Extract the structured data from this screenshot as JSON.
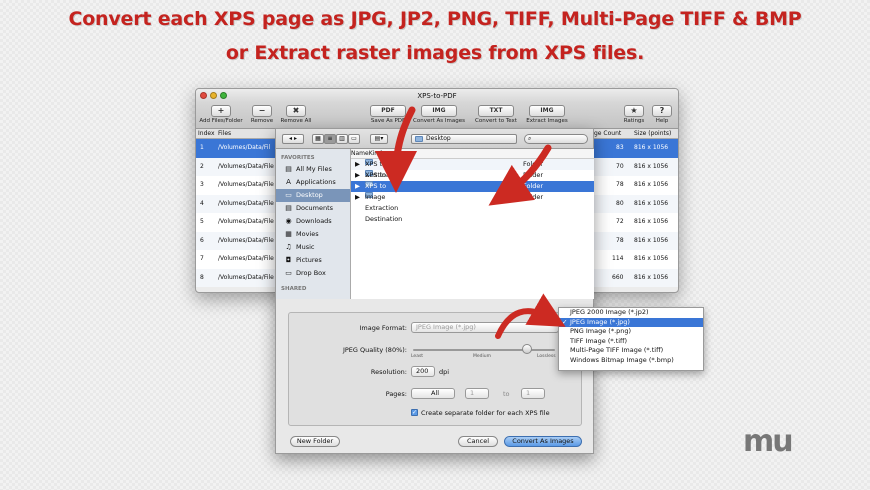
{
  "headline": {
    "line1": "Convert each XPS page as JPG, JP2, PNG, TIFF, Multi-Page TIFF & BMP",
    "line2": "or Extract raster images from XPS files."
  },
  "window": {
    "title": "XPS-to-PDF",
    "toolbar": {
      "add": {
        "icon": "+",
        "label": "Add Files/Folder"
      },
      "remove": {
        "icon": "−",
        "label": "Remove"
      },
      "remove_all": {
        "icon": "✖",
        "label": "Remove All"
      },
      "save_pdf": {
        "icon": "PDF",
        "label": "Save As PDF"
      },
      "conv_img": {
        "icon": "IMG",
        "label": "Convert As Images"
      },
      "conv_txt": {
        "icon": "TXT",
        "label": "Convert to Text"
      },
      "extract": {
        "icon": "IMG",
        "label": "Extract Images"
      },
      "ratings": {
        "icon": "★",
        "label": "Ratings"
      },
      "help": {
        "icon": "?",
        "label": "Help"
      }
    },
    "columns": {
      "index": "Index",
      "files": "Files",
      "page_count": "ge Count",
      "size": "Size (points)"
    },
    "rows": [
      {
        "i": "1",
        "f": "/Volumes/Data/Fil",
        "c": "83",
        "s": "816 x 1056"
      },
      {
        "i": "2",
        "f": "/Volumes/Data/File",
        "c": "70",
        "s": "816 x 1056"
      },
      {
        "i": "3",
        "f": "/Volumes/Data/File",
        "c": "78",
        "s": "816 x 1056"
      },
      {
        "i": "4",
        "f": "/Volumes/Data/File",
        "c": "80",
        "s": "816 x 1056"
      },
      {
        "i": "5",
        "f": "/Volumes/Data/File",
        "c": "72",
        "s": "816 x 1056"
      },
      {
        "i": "6",
        "f": "/Volumes/Data/File",
        "c": "78",
        "s": "816 x 1056"
      },
      {
        "i": "7",
        "f": "/Volumes/Data/File",
        "c": "114",
        "s": "816 x 1056"
      },
      {
        "i": "8",
        "f": "/Volumes/Data/File",
        "c": "660",
        "s": "816 x 1056"
      }
    ]
  },
  "sheet": {
    "location": "Desktop",
    "sidebar_favorites": "FAVORITES",
    "sidebar_shared": "SHARED",
    "sidebar": [
      {
        "icon": "▤",
        "label": "All My Files"
      },
      {
        "icon": "A",
        "label": "Applications"
      },
      {
        "icon": "▭",
        "label": "Desktop"
      },
      {
        "icon": "▤",
        "label": "Documents"
      },
      {
        "icon": "◉",
        "label": "Downloads"
      },
      {
        "icon": "▦",
        "label": "Movies"
      },
      {
        "icon": "♫",
        "label": "Music"
      },
      {
        "icon": "◘",
        "label": "Pictures"
      },
      {
        "icon": "▭",
        "label": "Drop Box"
      }
    ],
    "col_name": "Name",
    "col_kind": "Kind",
    "files": [
      {
        "name": "XPS to Text Destination",
        "kind": "Folder"
      },
      {
        "name": "XPS to PDF Destination",
        "kind": "Folder"
      },
      {
        "name": "XPS to Image Destination",
        "kind": "Folder"
      },
      {
        "name": "Image Extraction Destination",
        "kind": "Folder"
      }
    ],
    "options": {
      "format_label": "Image Format:",
      "format_value": "JPEG Image (*.jpg)",
      "quality_label": "JPEG Quality (80%):",
      "quality": 0.8,
      "q_least": "Least",
      "q_medium": "Medium",
      "q_lossless": "Lossless",
      "res_label": "Resolution:",
      "res_value": "200",
      "res_unit": "dpi",
      "pages_label": "Pages:",
      "pages_value": "All",
      "from": "1",
      "to_label": "to",
      "to": "1",
      "checkbox": "Create separate folder for each XPS file"
    },
    "new_folder": "New Folder",
    "cancel": "Cancel",
    "convert": "Convert As Images"
  },
  "menu": {
    "items": [
      "JPEG 2000 Image (*.jp2)",
      "JPEG Image (*.jpg)",
      "PNG Image (*.png)",
      "TIFF Image (*.tiff)",
      "Multi-Page TIFF Image (*.tiff)",
      "Windows Bitmap Image (*.bmp)"
    ],
    "selected_mark": "✓"
  },
  "colors": {
    "headline": "#c4231f",
    "arrow": "#cc2a22",
    "selection": "#3a76d6"
  }
}
